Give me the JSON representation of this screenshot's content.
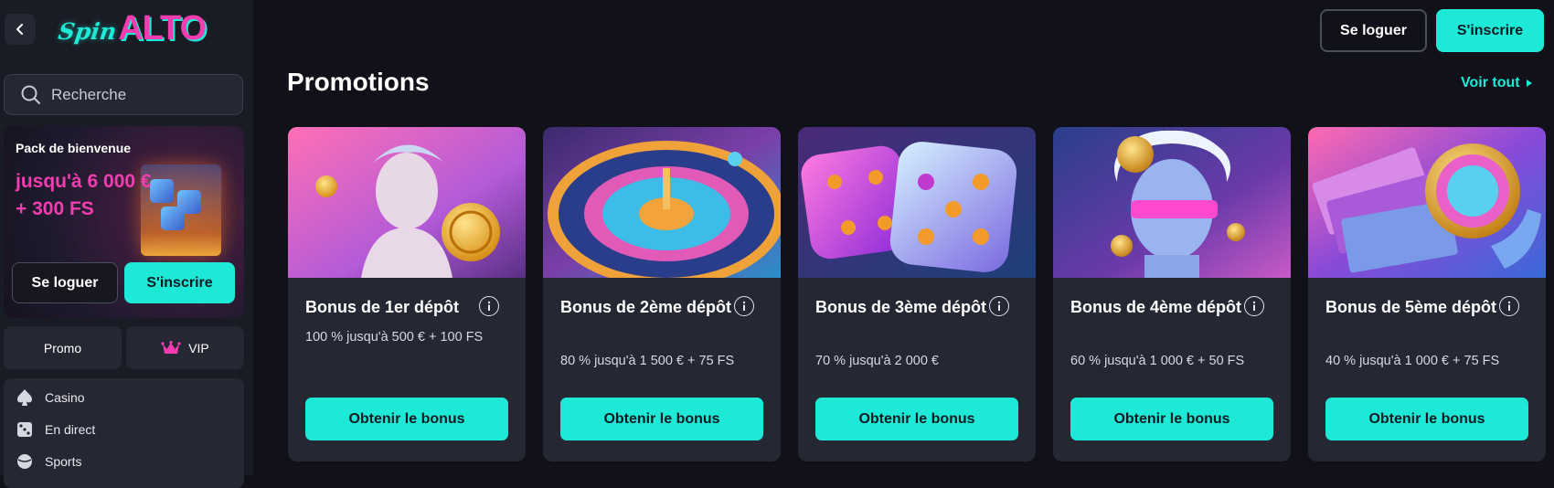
{
  "brand": {
    "logo_spin": "Spin",
    "logo_alto": "ALTO"
  },
  "icons": {
    "back": "chevron-left-icon",
    "search": "search-icon",
    "vip": "crown-icon",
    "casino": "spade-icon",
    "live": "dice-icon",
    "sports": "ball-icon",
    "info": "info-icon",
    "see_all": "caret-right-icon"
  },
  "colors": {
    "accent": "#1de9d6",
    "brand_pink": "#f23db0",
    "background": "#111219",
    "panel": "#252733"
  },
  "sidebar": {
    "search_placeholder": "Recherche",
    "welcome": {
      "title": "Pack de bienvenue",
      "amount": "jusqu'à 6 000 €\n+ 300 FS",
      "login": "Se loguer",
      "signup": "S'inscrire"
    },
    "promo": "Promo",
    "vip": "VIP",
    "nav": [
      {
        "label": "Casino"
      },
      {
        "label": "En direct"
      },
      {
        "label": "Sports"
      }
    ]
  },
  "header": {
    "login": "Se loguer",
    "signup": "S'inscrire"
  },
  "main": {
    "title": "Promotions",
    "see_all": "Voir tout",
    "cards": [
      {
        "title": "Bonus de 1er dépôt",
        "desc": "100 % jusqu'à 500 € + 100 FS",
        "button": "Obtenir le bonus"
      },
      {
        "title": "Bonus de 2ème dépôt",
        "desc": "80 % jusqu'à 1 500 € + 75 FS",
        "button": "Obtenir le bonus"
      },
      {
        "title": "Bonus de 3ème dépôt",
        "desc": "70 % jusqu'à 2 000 €",
        "button": "Obtenir le bonus"
      },
      {
        "title": "Bonus de 4ème dépôt",
        "desc": "60 % jusqu'à 1 000 € + 50 FS",
        "button": "Obtenir le bonus"
      },
      {
        "title": "Bonus de 5ème dépôt",
        "desc": "40 % jusqu'à 1 000 € + 75 FS",
        "button": "Obtenir le bonus"
      }
    ]
  }
}
